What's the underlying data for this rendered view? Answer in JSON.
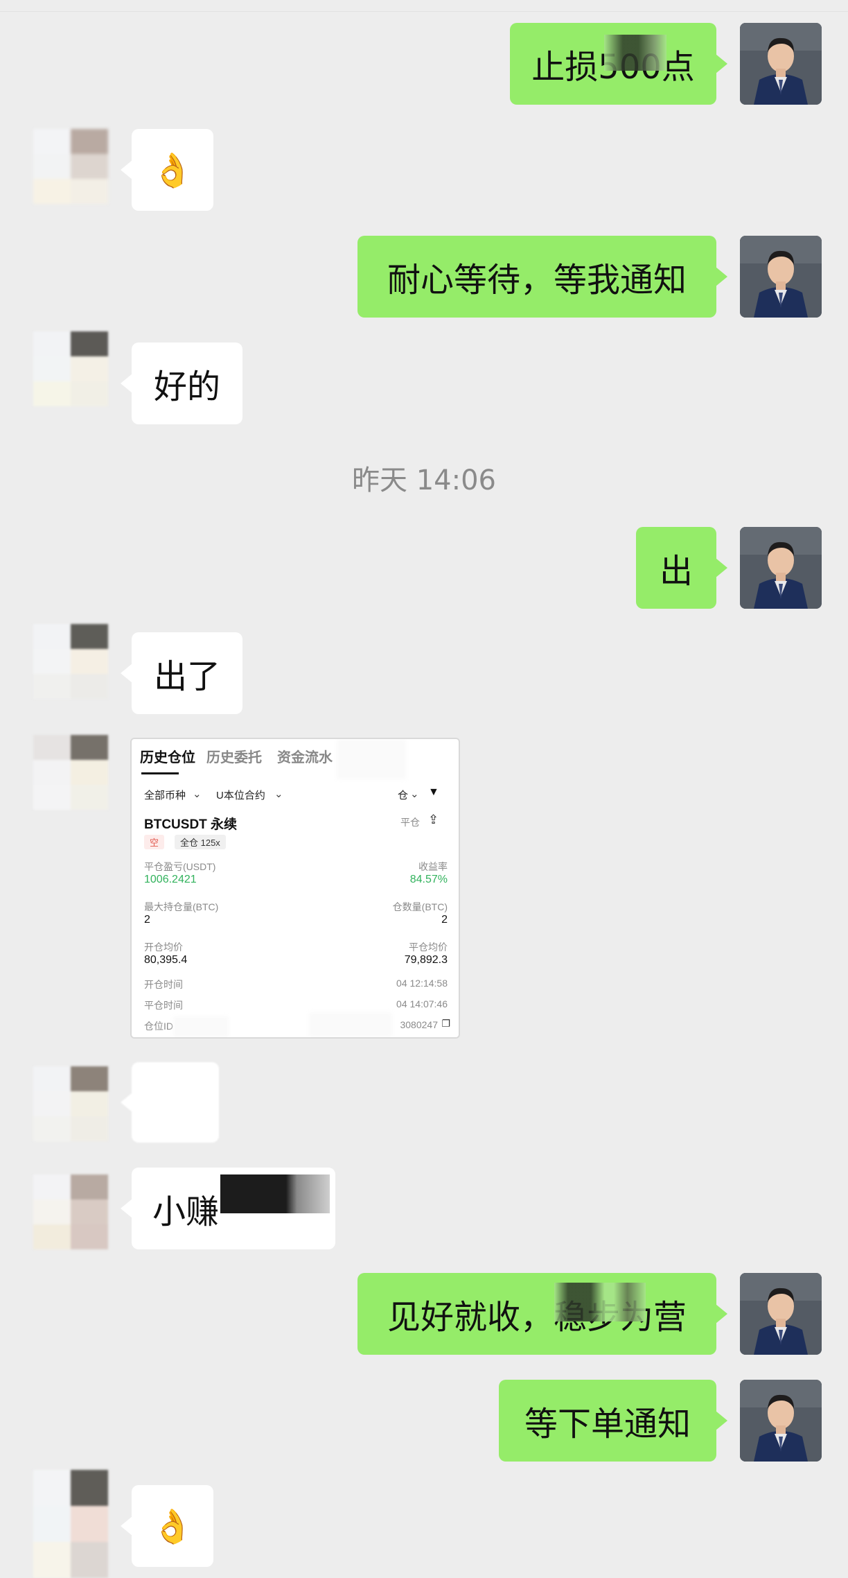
{
  "messages": [
    {
      "side": "me",
      "text": "止损500点"
    },
    {
      "side": "them",
      "emoji": "👌"
    },
    {
      "side": "me",
      "text": "耐心等待，等我通知"
    },
    {
      "side": "them",
      "text": "好的"
    },
    {
      "side": "me",
      "text": "出"
    },
    {
      "side": "them",
      "text": "出了"
    },
    {
      "side": "them",
      "text": "小赚"
    },
    {
      "side": "me",
      "text": "见好就收，稳步为营"
    },
    {
      "side": "me",
      "text": "等下单通知"
    },
    {
      "side": "them",
      "emoji": "👌"
    }
  ],
  "timestamp": "昨天 14:06",
  "position_card": {
    "tabs": [
      "历史仓位",
      "历史委托",
      "资金流水"
    ],
    "filter_all": "全部币种",
    "filter_contract": "U本位合约",
    "filter_right": "仓",
    "symbol": "BTCUSDT 永续",
    "side_tag": "空",
    "margin_tag": "全仓 125x",
    "close_tag": "平仓",
    "pnl_label": "平仓盈亏(USDT)",
    "pnl_value": "1006.2421",
    "roi_label": "收益率",
    "roi_value": "84.57%",
    "max_hold_label": "最大持仓量(BTC)",
    "max_hold_value": "2",
    "close_qty_label": "仓数量(BTC)",
    "close_qty_value": "2",
    "open_avg_label": "开仓均价",
    "open_avg_value": "80,395.4",
    "close_avg_label": "平仓均价",
    "close_avg_value": "79,892.3",
    "open_time_label": "开仓时间",
    "open_time_value": "04 12:14:58",
    "close_time_label": "平仓时间",
    "close_time_value": "04 14:07:46",
    "id_label": "仓位ID",
    "id_value": "3080247"
  },
  "colors": {
    "background": "#ededed",
    "bubble_me": "#95ec69",
    "bubble_them": "#ffffff",
    "profit_green": "#31b25c"
  }
}
